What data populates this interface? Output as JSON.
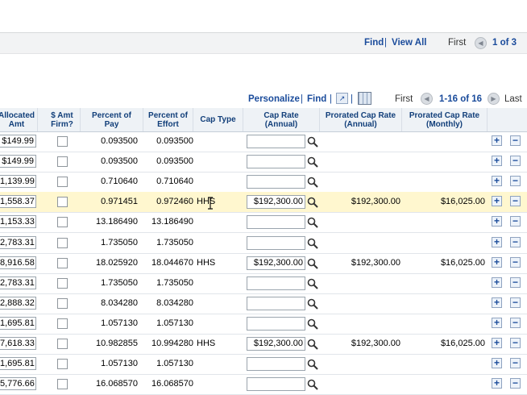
{
  "top_nav": {
    "find": "Find",
    "separator": "|",
    "view_all": "View All",
    "first": "First",
    "prev_icon": "prev-arrow-icon",
    "page_range": "1 of 3"
  },
  "grid_toolbar": {
    "personalize": "Personalize",
    "separator": "|",
    "find": "Find",
    "zoom_icon": "new-window-icon",
    "grid_icon": "download-grid-icon",
    "first": "First",
    "prev_icon": "prev-arrow-icon",
    "row_range": "1-16 of 16",
    "next_icon": "next-arrow-icon",
    "last": "Last"
  },
  "columns": {
    "allocated_amt": "Allocated\nAmt",
    "amt_firm": "$ Amt\nFirm?",
    "percent_of_pay": "Percent of\nPay",
    "percent_of_effort": "Percent of\nEffort",
    "cap_type": "Cap Type",
    "cap_rate": "Cap Rate\n(Annual)",
    "prorated_annual": "Prorated Cap Rate\n(Annual)",
    "prorated_monthly": "Prorated Cap Rate\n(Monthly)"
  },
  "rows": [
    {
      "alloc": "$149.99",
      "pay": "0.093500",
      "effort": "0.093500",
      "cap_type": "",
      "cap_rate": "",
      "pro_annual": "",
      "pro_monthly": ""
    },
    {
      "alloc": "$149.99",
      "pay": "0.093500",
      "effort": "0.093500",
      "cap_type": "",
      "cap_rate": "",
      "pro_annual": "",
      "pro_monthly": ""
    },
    {
      "alloc": "1,139.99",
      "pay": "0.710640",
      "effort": "0.710640",
      "cap_type": "",
      "cap_rate": "",
      "pro_annual": "",
      "pro_monthly": ""
    },
    {
      "alloc": "1,558.37",
      "pay": "0.971451",
      "effort": "0.972460",
      "cap_type": "HHS",
      "cap_rate": "$192,300.00",
      "pro_annual": "$192,300.00",
      "pro_monthly": "$16,025.00"
    },
    {
      "alloc": "1,153.33",
      "pay": "13.186490",
      "effort": "13.186490",
      "cap_type": "",
      "cap_rate": "",
      "pro_annual": "",
      "pro_monthly": ""
    },
    {
      "alloc": "2,783.31",
      "pay": "1.735050",
      "effort": "1.735050",
      "cap_type": "",
      "cap_rate": "",
      "pro_annual": "",
      "pro_monthly": ""
    },
    {
      "alloc": "8,916.58",
      "pay": "18.025920",
      "effort": "18.044670",
      "cap_type": "HHS",
      "cap_rate": "$192,300.00",
      "pro_annual": "$192,300.00",
      "pro_monthly": "$16,025.00"
    },
    {
      "alloc": "2,783.31",
      "pay": "1.735050",
      "effort": "1.735050",
      "cap_type": "",
      "cap_rate": "",
      "pro_annual": "",
      "pro_monthly": ""
    },
    {
      "alloc": "2,888.32",
      "pay": "8.034280",
      "effort": "8.034280",
      "cap_type": "",
      "cap_rate": "",
      "pro_annual": "",
      "pro_monthly": ""
    },
    {
      "alloc": "1,695.81",
      "pay": "1.057130",
      "effort": "1.057130",
      "cap_type": "",
      "cap_rate": "",
      "pro_annual": "",
      "pro_monthly": ""
    },
    {
      "alloc": "7,618.33",
      "pay": "10.982855",
      "effort": "10.994280",
      "cap_type": "HHS",
      "cap_rate": "$192,300.00",
      "pro_annual": "$192,300.00",
      "pro_monthly": "$16,025.00"
    },
    {
      "alloc": "1,695.81",
      "pay": "1.057130",
      "effort": "1.057130",
      "cap_type": "",
      "cap_rate": "",
      "pro_annual": "",
      "pro_monthly": ""
    },
    {
      "alloc": "5,776.66",
      "pay": "16.068570",
      "effort": "16.068570",
      "cap_type": "",
      "cap_rate": "",
      "pro_annual": "",
      "pro_monthly": ""
    }
  ],
  "highlighted_row": 3,
  "colors": {
    "link": "#1a4b9b",
    "header_text": "#123f7a",
    "row_highlight": "#fff7cf"
  },
  "row_buttons": {
    "add": "+",
    "delete": "−",
    "lookup_icon": "magnifier-icon",
    "add_icon": "plus-icon",
    "delete_icon": "minus-icon"
  }
}
